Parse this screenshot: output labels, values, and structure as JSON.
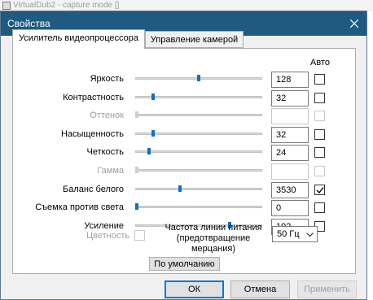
{
  "background_window": {
    "title": "VirtualDub2 - capture mode []"
  },
  "dialog": {
    "title": "Свойства",
    "close_icon": "close-icon"
  },
  "tabs": [
    {
      "label": "Усилитель видеопроцессора",
      "active": true
    },
    {
      "label": "Управление камерой",
      "active": false
    }
  ],
  "auto_header": "Авто",
  "properties": [
    {
      "label": "Яркость",
      "value": "128",
      "level": 0.5,
      "auto": false,
      "enabled": true
    },
    {
      "label": "Контрастность",
      "value": "32",
      "level": 0.13,
      "auto": false,
      "enabled": true
    },
    {
      "label": "Оттенок",
      "value": "",
      "level": 0.0,
      "auto": false,
      "enabled": false
    },
    {
      "label": "Насыщенность",
      "value": "32",
      "level": 0.13,
      "auto": false,
      "enabled": true
    },
    {
      "label": "Четкость",
      "value": "24",
      "level": 0.1,
      "auto": false,
      "enabled": true
    },
    {
      "label": "Гамма",
      "value": "",
      "level": 0.0,
      "auto": false,
      "enabled": false
    },
    {
      "label": "Баланс белого",
      "value": "3530",
      "level": 0.35,
      "auto": true,
      "enabled": true
    },
    {
      "label": "Съемка против света",
      "value": "0",
      "level": 0.0,
      "auto": false,
      "enabled": true
    },
    {
      "label": "Усиление",
      "value": "192",
      "level": 0.75,
      "auto": false,
      "enabled": true
    }
  ],
  "color": {
    "label": "Цветность",
    "checked": false,
    "enabled": false
  },
  "power_line": {
    "label": "Частота линии питания (предотвращение мерцания)",
    "label_line1": "Частота линии питания",
    "label_line2": "(предотвращение",
    "label_line3": "мерцания)",
    "selected": "50 Гц"
  },
  "buttons": {
    "default": "По умолчанию",
    "ok": "ОК",
    "cancel": "Отмена",
    "apply": "Применить"
  },
  "colors": {
    "titlebar": "#1f5a80",
    "slider_thumb": "#0f6fc5",
    "focus_border": "#0078d7"
  }
}
